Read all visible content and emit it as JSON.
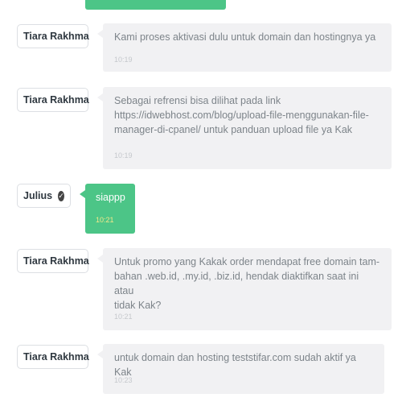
{
  "messages": [
    {
      "sender": "Tiara Rakhma",
      "verified": false,
      "own": false,
      "text": "Kami proses aktivasi dulu untuk domain dan hostingnya ya",
      "time": "10:19"
    },
    {
      "sender": "Tiara Rakhma",
      "verified": false,
      "own": false,
      "lines": [
        "Sebagai refrensi bisa dilihat pada link",
        "https://idwebhost.com/blog/upload-file-menggunakan-file-",
        "manager-di-cpanel/ untuk panduan upload file ya Kak"
      ],
      "time": "10:19"
    },
    {
      "sender": "Julius",
      "verified": true,
      "own": true,
      "text": "siappp",
      "time": "10:21"
    },
    {
      "sender": "Tiara Rakhma",
      "verified": false,
      "own": false,
      "lines": [
        "Untuk promo yang Kakak order mendapat free domain tam-",
        "bahan .web.id, .my.id, .biz.id, hendak diaktifkan saat ini atau",
        "tidak Kak?"
      ],
      "time": "10:21"
    },
    {
      "sender": "Tiara Rakhma",
      "verified": false,
      "own": false,
      "text": "untuk domain dan hosting teststifar.com sudah aktif ya Kak",
      "time": "10:23"
    }
  ],
  "icons": {
    "verified": "check-circle-icon"
  },
  "colors": {
    "own_bubble": "#4cc587",
    "other_bubble": "#f1f1f3",
    "own_time": "#f2e98a"
  }
}
